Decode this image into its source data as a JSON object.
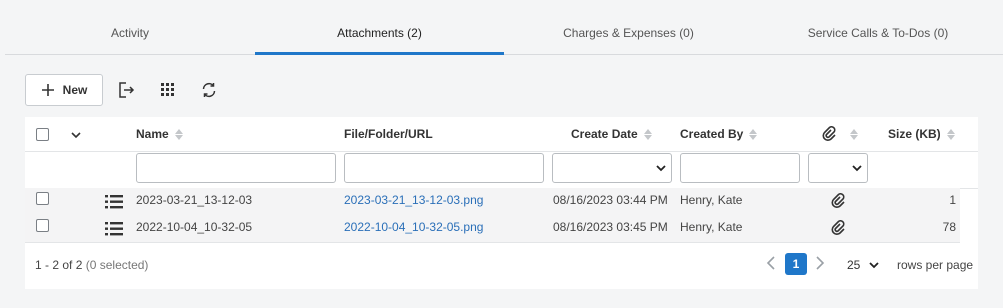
{
  "tabs": [
    {
      "label": "Activity"
    },
    {
      "label": "Attachments (2)"
    },
    {
      "label": "Charges & Expenses (0)"
    },
    {
      "label": "Service Calls & To-Dos (0)"
    }
  ],
  "toolbar": {
    "new_label": "New",
    "icons": [
      "export-icon",
      "grid-columns-icon",
      "refresh-icon"
    ]
  },
  "grid": {
    "columns": {
      "name": "Name",
      "file": "File/Folder/URL",
      "create_date": "Create Date",
      "created_by": "Created By",
      "size": "Size (KB)"
    },
    "rows": [
      {
        "name": "2023-03-21_13-12-03",
        "file": "2023-03-21_13-12-03.png",
        "create_date": "08/16/2023 03:44 PM",
        "created_by": "Henry, Kate",
        "size": "1"
      },
      {
        "name": "2022-10-04_10-32-05",
        "file": "2022-10-04_10-32-05.png",
        "create_date": "08/16/2023 03:45 PM",
        "created_by": "Henry, Kate",
        "size": "78"
      }
    ]
  },
  "footer": {
    "range": "1 - 2 of 2",
    "selected": "(0 selected)",
    "page": "1",
    "page_size": "25",
    "rows_per_page": "rows per page"
  },
  "colors": {
    "accent": "#1f77c9",
    "link": "#2a6fb8"
  }
}
